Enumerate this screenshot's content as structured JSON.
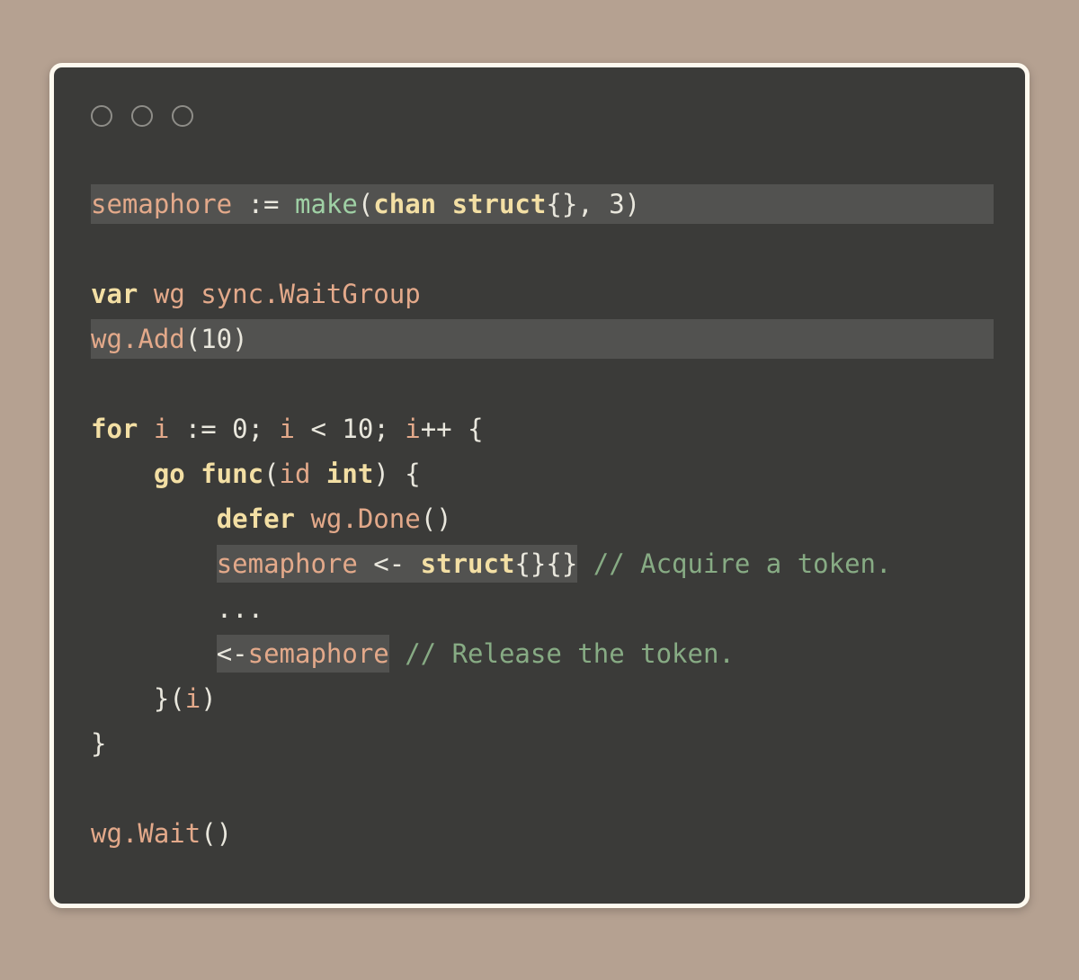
{
  "window": {
    "background_color": "#b5a191",
    "surface_color": "#3b3b39",
    "border_color": "#fdf9ef",
    "highlight_color": "#525250",
    "traffic_lights": [
      "close-dot",
      "minimize-dot",
      "maximize-dot"
    ]
  },
  "theme": {
    "plain": "#e9e7dd",
    "variable": "#e3a98a",
    "keyword": "#f3dfa4",
    "function": "#9fd0a5",
    "comment": "#87ab84"
  },
  "code": {
    "language": "go",
    "lines": [
      {
        "n": 1,
        "highlight": "full",
        "text": "semaphore := make(chan struct{}, 3)",
        "tokens": [
          {
            "t": "semaphore",
            "c": "variable"
          },
          {
            "t": " := ",
            "c": "plain"
          },
          {
            "t": "make",
            "c": "function"
          },
          {
            "t": "(",
            "c": "plain"
          },
          {
            "t": "chan struct",
            "c": "keyword"
          },
          {
            "t": "{}, 3)",
            "c": "plain"
          }
        ]
      },
      {
        "n": 2,
        "highlight": "none",
        "text": "",
        "tokens": []
      },
      {
        "n": 3,
        "highlight": "none",
        "text": "var wg sync.WaitGroup",
        "tokens": [
          {
            "t": "var",
            "c": "keyword"
          },
          {
            "t": " ",
            "c": "plain"
          },
          {
            "t": "wg sync.WaitGroup",
            "c": "variable"
          }
        ]
      },
      {
        "n": 4,
        "highlight": "full",
        "text": "wg.Add(10)",
        "tokens": [
          {
            "t": "wg.Add",
            "c": "variable"
          },
          {
            "t": "(10)",
            "c": "plain"
          }
        ]
      },
      {
        "n": 5,
        "highlight": "none",
        "text": "",
        "tokens": []
      },
      {
        "n": 6,
        "highlight": "none",
        "text": "for i := 0; i < 10; i++ {",
        "tokens": [
          {
            "t": "for",
            "c": "keyword"
          },
          {
            "t": " ",
            "c": "plain"
          },
          {
            "t": "i",
            "c": "variable"
          },
          {
            "t": " := 0; ",
            "c": "plain"
          },
          {
            "t": "i",
            "c": "variable"
          },
          {
            "t": " < 10; ",
            "c": "plain"
          },
          {
            "t": "i",
            "c": "variable"
          },
          {
            "t": "++ {",
            "c": "plain"
          }
        ]
      },
      {
        "n": 7,
        "highlight": "none",
        "text": "    go func(id int) {",
        "tokens": [
          {
            "t": "    ",
            "c": "plain"
          },
          {
            "t": "go func",
            "c": "keyword"
          },
          {
            "t": "(",
            "c": "plain"
          },
          {
            "t": "id",
            "c": "variable"
          },
          {
            "t": " ",
            "c": "plain"
          },
          {
            "t": "int",
            "c": "keyword"
          },
          {
            "t": ") {",
            "c": "plain"
          }
        ]
      },
      {
        "n": 8,
        "highlight": "none",
        "text": "        defer wg.Done()",
        "tokens": [
          {
            "t": "        ",
            "c": "plain"
          },
          {
            "t": "defer",
            "c": "keyword"
          },
          {
            "t": " ",
            "c": "plain"
          },
          {
            "t": "wg.Done",
            "c": "variable"
          },
          {
            "t": "()",
            "c": "plain"
          }
        ]
      },
      {
        "n": 9,
        "highlight": "inline",
        "text": "        semaphore <- struct{}{} // Acquire a token.",
        "tokens": [
          {
            "t": "        ",
            "c": "plain"
          },
          {
            "t": "semaphore",
            "c": "variable",
            "hl": true
          },
          {
            "t": " <- ",
            "c": "plain",
            "hl": true
          },
          {
            "t": "struct",
            "c": "keyword",
            "hl": true
          },
          {
            "t": "{}{}",
            "c": "plain",
            "hl": true
          },
          {
            "t": " ",
            "c": "plain"
          },
          {
            "t": "// Acquire a token.",
            "c": "comment"
          }
        ]
      },
      {
        "n": 10,
        "highlight": "none",
        "text": "        ...",
        "tokens": [
          {
            "t": "        ",
            "c": "plain"
          },
          {
            "t": "...",
            "c": "plain"
          }
        ]
      },
      {
        "n": 11,
        "highlight": "inline",
        "text": "        <-semaphore // Release the token.",
        "tokens": [
          {
            "t": "        ",
            "c": "plain"
          },
          {
            "t": "<-",
            "c": "plain",
            "hl": true
          },
          {
            "t": "semaphore",
            "c": "variable",
            "hl": true
          },
          {
            "t": " ",
            "c": "plain"
          },
          {
            "t": "// Release the token.",
            "c": "comment"
          }
        ]
      },
      {
        "n": 12,
        "highlight": "none",
        "text": "    }(i)",
        "tokens": [
          {
            "t": "    }(",
            "c": "plain"
          },
          {
            "t": "i",
            "c": "variable"
          },
          {
            "t": ")",
            "c": "plain"
          }
        ]
      },
      {
        "n": 13,
        "highlight": "none",
        "text": "}",
        "tokens": [
          {
            "t": "}",
            "c": "plain"
          }
        ]
      },
      {
        "n": 14,
        "highlight": "none",
        "text": "",
        "tokens": []
      },
      {
        "n": 15,
        "highlight": "none",
        "text": "wg.Wait()",
        "tokens": [
          {
            "t": "wg.Wait",
            "c": "variable"
          },
          {
            "t": "()",
            "c": "plain"
          }
        ]
      }
    ]
  }
}
